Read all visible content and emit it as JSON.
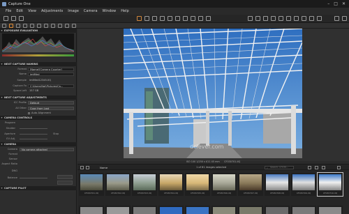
{
  "app": {
    "title": "Capture One"
  },
  "menu": [
    "File",
    "Edit",
    "View",
    "Adjustments",
    "Image",
    "Camera",
    "Window",
    "Help"
  ],
  "sections": {
    "exposure": "EXPOSURE EVALUATION",
    "naming": "NEXT CAPTURE NAMING",
    "adjust": "NEXT CAPTURE ADJUSTMENTS",
    "controls": "CAMERA CONTROLS",
    "camera": "CAMERA",
    "pilot": "CAPTURE PILOT"
  },
  "naming": {
    "format_label": "Format",
    "format_value": "[Name][Camera Counter]",
    "name_label": "Name",
    "name_value": "imtMed",
    "sample_label": "Sample",
    "sample_value": "imtMed12345.IIQ",
    "folder_label": "Capture Fo",
    "folder_value": "C:\\Users\\Nat\\Pictures\\Ca...",
    "space_label": "Space Left",
    "space_value": "157 GB"
  },
  "adjust": {
    "icc_label": "ICC Profile",
    "icc_value": "Default",
    "all_label": "All Other",
    "all_value": "Copy from Last",
    "auto_label": "Auto Alignment"
  },
  "controls": {
    "program": "Program",
    "shutter": "Shutter",
    "aperture": "Aperture",
    "ev": "EV Adj.",
    "stop": "Stop"
  },
  "camera": {
    "camera_label": "Camera",
    "camera_value": "No camera attached",
    "format_label": "Format",
    "sensor_label": "Sensor",
    "aspect_label": "Aspect Ratio",
    "dng_label": "DNG",
    "balance_label": "Balance"
  },
  "viewer": {
    "watermark": "dclever.com",
    "info": "ISO 100  1/250 s  f/11  45 mm",
    "filename": "CF030701.IIQ"
  },
  "browser": {
    "sort": "Name",
    "count": "1 of 61 images selected",
    "search_placeholder": "Search: CF030..."
  },
  "thumbnails": [
    {
      "cap": "CF030701.IIQ"
    },
    {
      "cap": "CF030702.IIQ"
    },
    {
      "cap": "CF030703.IIQ"
    },
    {
      "cap": "CF030704.IIQ"
    },
    {
      "cap": "CF030705.IIQ"
    },
    {
      "cap": "CF030706.IIQ"
    },
    {
      "cap": "CF030707.IIQ"
    },
    {
      "cap": "CF030708.IIQ"
    },
    {
      "cap": "CF030709.IIQ"
    },
    {
      "cap": "CF030710.IIQ"
    }
  ],
  "colors": {
    "accent": "#e08a32",
    "panel": "#2d2d2d",
    "sky": "#3d7fc9"
  }
}
